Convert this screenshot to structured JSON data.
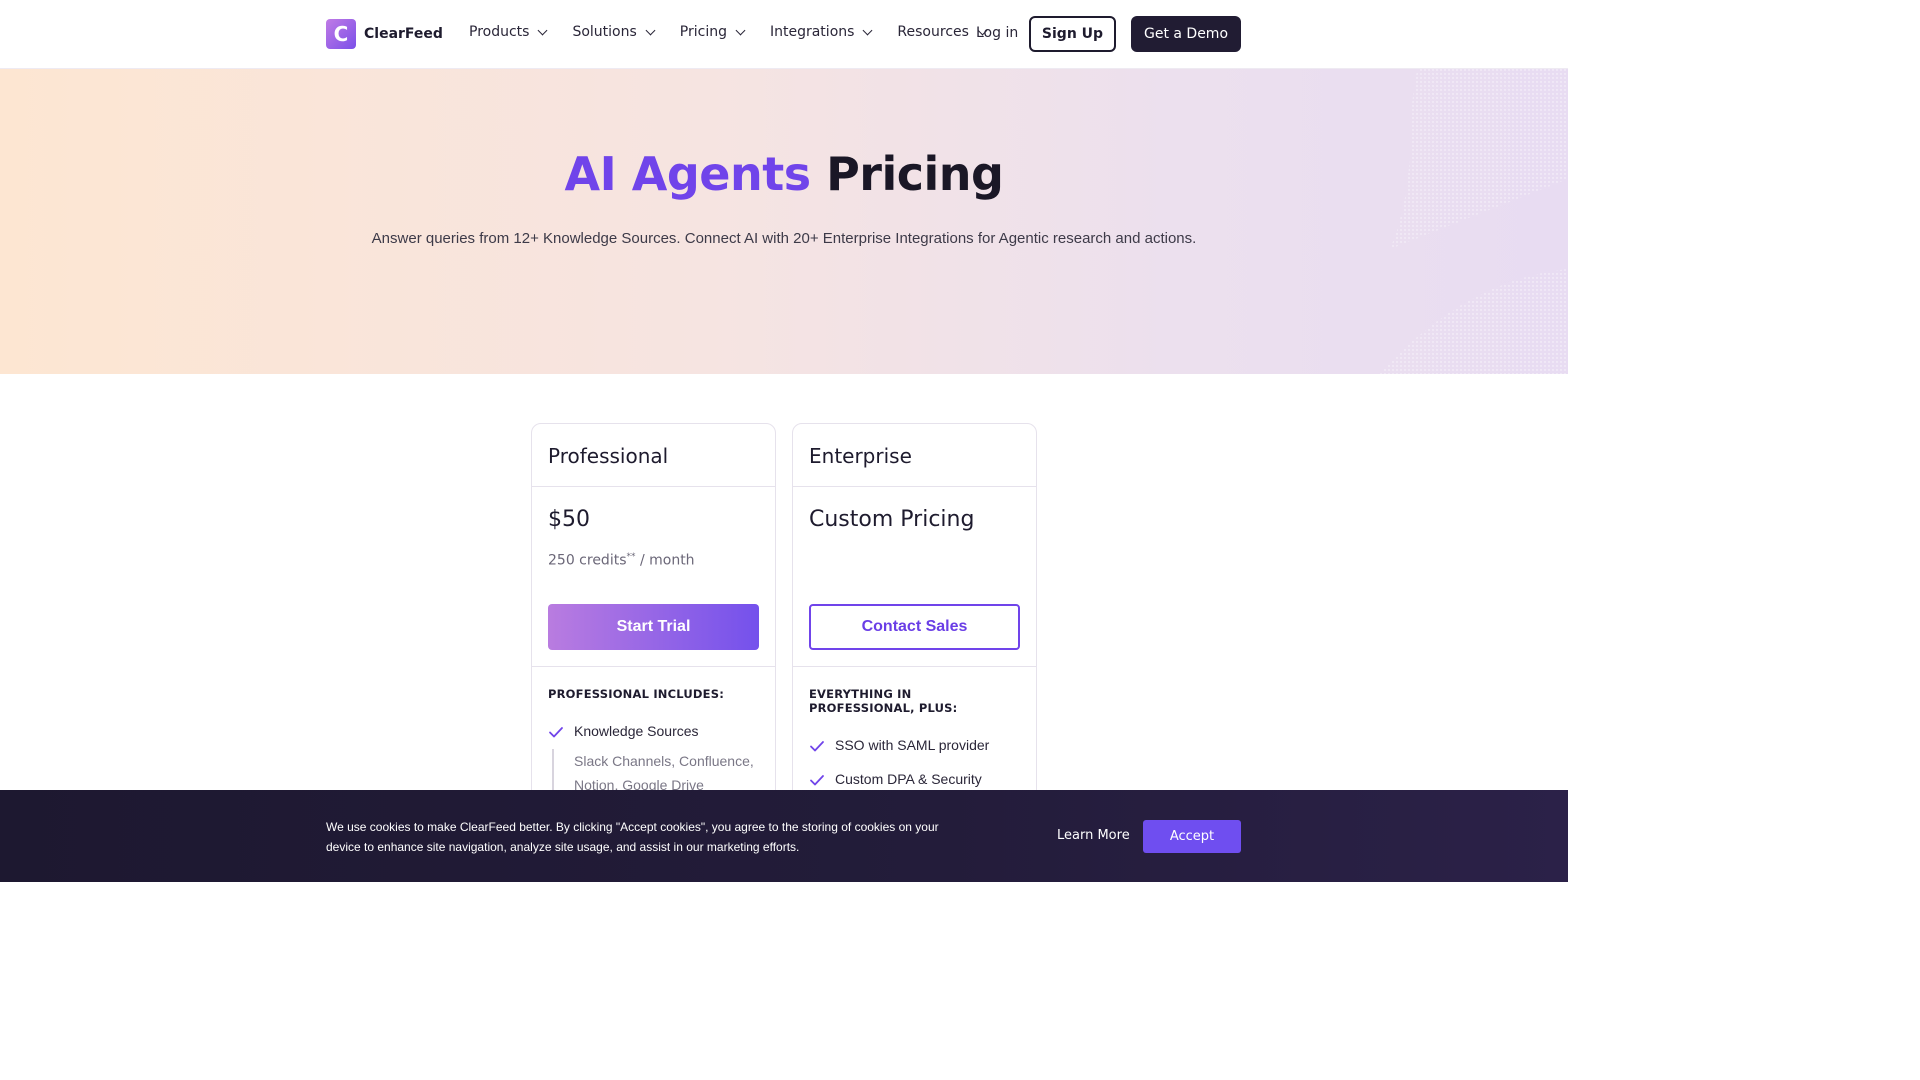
{
  "brand": {
    "name": "ClearFeed",
    "logo_letter": "C",
    "accent": "#7044ea"
  },
  "nav": {
    "items": [
      {
        "label": "Products"
      },
      {
        "label": "Solutions"
      },
      {
        "label": "Pricing"
      },
      {
        "label": "Integrations"
      },
      {
        "label": "Resources"
      }
    ],
    "login": "Log in",
    "signup": "Sign Up",
    "demo": "Get a Demo"
  },
  "hero": {
    "title_accent": "AI Agents",
    "title_rest": "Pricing",
    "subtitle": "Answer queries from 12+ Knowledge Sources. Connect AI with 20+ Enterprise Integrations for Agentic research and actions."
  },
  "plans": {
    "professional": {
      "name": "Professional",
      "price": "$50",
      "credits": "250 credits",
      "credits_mark": "**",
      "period": " / month",
      "cta": "Start Trial",
      "features_heading": "PROFESSIONAL INCLUDES:",
      "features": [
        {
          "label": "Knowledge Sources",
          "sub": "Slack Channels, Confluence, Notion, Google Drive"
        }
      ]
    },
    "enterprise": {
      "name": "Enterprise",
      "price": "Custom Pricing",
      "cta": "Contact Sales",
      "features_heading": "EVERYTHING IN PROFESSIONAL, PLUS:",
      "features": [
        {
          "label": "SSO with SAML provider"
        },
        {
          "label": "Custom DPA & Security Review"
        }
      ]
    }
  },
  "cookie": {
    "text": "We use cookies to make ClearFeed better. By clicking \"Accept cookies\", you agree to the storing of cookies on your device to enhance site navigation, analyze site usage, and assist in our marketing efforts.",
    "learn_more": "Learn More",
    "accept": "Accept"
  }
}
